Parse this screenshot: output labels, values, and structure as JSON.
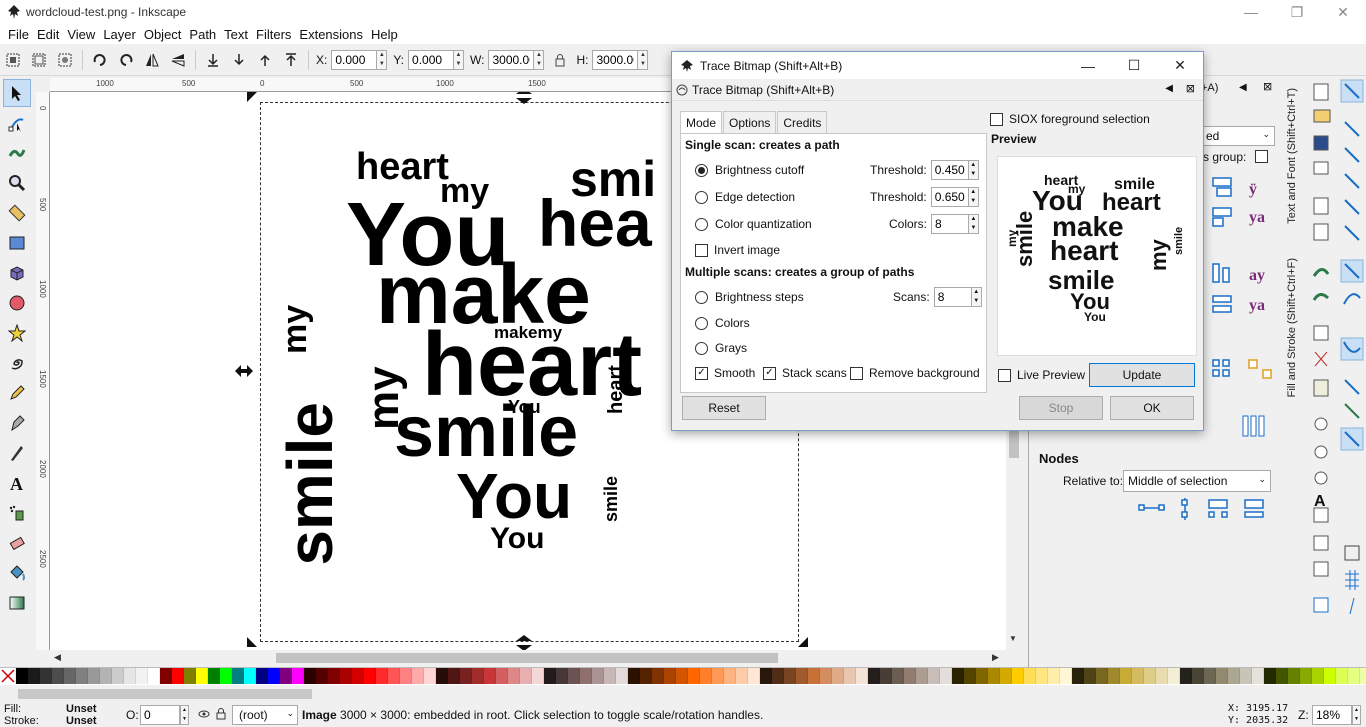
{
  "window": {
    "title": "wordcloud-test.png - Inkscape",
    "minimize": "—",
    "restore": "❐",
    "close": "✕"
  },
  "menu": [
    "File",
    "Edit",
    "View",
    "Layer",
    "Object",
    "Path",
    "Text",
    "Filters",
    "Extensions",
    "Help"
  ],
  "controls": {
    "x_label": "X:",
    "x_value": "0.000",
    "y_label": "Y:",
    "y_value": "0.000",
    "w_label": "W:",
    "w_value": "3000.00",
    "h_label": "H:",
    "h_value": "3000.00"
  },
  "ruler": {
    "top_labels": [
      "1000",
      "500",
      "0",
      "500",
      "1000",
      "1500"
    ],
    "left_labels": [
      "0",
      "500",
      "1000",
      "1500",
      "2000",
      "2500"
    ]
  },
  "canvas_words": [
    "heart",
    "my",
    "smi",
    "smile",
    "You",
    "hea",
    "my",
    "make",
    "makemy",
    "smile",
    "my",
    "heart",
    "heart",
    "You",
    "my",
    "smile",
    "smile",
    "You",
    "You"
  ],
  "dialog": {
    "title": "Trace Bitmap (Shift+Alt+B)",
    "subtitle": "Trace Bitmap (Shift+Alt+B)",
    "tabs": [
      "Mode",
      "Options",
      "Credits"
    ],
    "single_scan_header": "Single scan: creates a path",
    "brightness_cutoff": "Brightness cutoff",
    "edge_detection": "Edge detection",
    "color_quantization": "Color quantization",
    "invert_image": "Invert image",
    "threshold_label": "Threshold:",
    "threshold_1": "0.450",
    "threshold_2": "0.650",
    "colors_label": "Colors:",
    "colors_value": "8",
    "multi_scan_header": "Multiple scans: creates a group of paths",
    "brightness_steps": "Brightness steps",
    "scans_label": "Scans:",
    "scans_value": "8",
    "colors_opt": "Colors",
    "grays_opt": "Grays",
    "smooth": "Smooth",
    "stack_scans": "Stack scans",
    "remove_background": "Remove background",
    "siox": "SIOX foreground selection",
    "preview_label": "Preview",
    "live_preview": "Live Preview",
    "update": "Update",
    "reset": "Reset",
    "stop": "Stop",
    "ok": "OK"
  },
  "dock": {
    "ed_text": "ed",
    "as_group": "s group:",
    "a_tag": "+A)",
    "nodes_header": "Nodes",
    "relative_to_label": "Relative to:",
    "relative_to_value": "Middle of selection"
  },
  "vertical_tabs": {
    "text_font": "Text and Font (Shift+Ctrl+T)",
    "fill_stroke": "Fill and Stroke (Shift+Ctrl+F)"
  },
  "palette": [
    "#000000",
    "#1a1a1a",
    "#333333",
    "#4d4d4d",
    "#666666",
    "#808080",
    "#999999",
    "#b3b3b3",
    "#cccccc",
    "#e6e6e6",
    "#f2f2f2",
    "#ffffff",
    "#800000",
    "#ff0000",
    "#808000",
    "#ffff00",
    "#008000",
    "#00ff00",
    "#008080",
    "#00ffff",
    "#000080",
    "#0000ff",
    "#800080",
    "#ff00ff",
    "#2b0000",
    "#550000",
    "#800000",
    "#aa0000",
    "#d40000",
    "#ff0000",
    "#ff2a2a",
    "#ff5555",
    "#ff8080",
    "#ffaaaa",
    "#ffd5d5",
    "#280b0b",
    "#501616",
    "#782121",
    "#a02c2c",
    "#c83737",
    "#d35f5f",
    "#de8787",
    "#e9afaf",
    "#f4d7d7",
    "#241c1c",
    "#483737",
    "#6c5353",
    "#916f6f",
    "#ac9393",
    "#c8b7b7",
    "#e3dbdb",
    "#2b1100",
    "#552200",
    "#803300",
    "#aa4400",
    "#d45500",
    "#ff6600",
    "#ff7f2a",
    "#ff9955",
    "#ffb380",
    "#ffccaa",
    "#ffe6d5",
    "#28170b",
    "#502d16",
    "#784421",
    "#a05a2c",
    "#c87137",
    "#d38d5f",
    "#deaa87",
    "#e9c6af",
    "#f4e3d7",
    "#241f1c",
    "#483e37",
    "#6c5d53",
    "#917c6f",
    "#ac9d93",
    "#c8beb7",
    "#e3dedb",
    "#2b2200",
    "#554400",
    "#806600",
    "#aa8800",
    "#d4aa00",
    "#ffcc00",
    "#ffdd55",
    "#ffe680",
    "#ffeeaa",
    "#fff6d5",
    "#28220b",
    "#504416",
    "#786721",
    "#a0892c",
    "#c8ab37",
    "#d3bc5f",
    "#decd87",
    "#e9ddaf",
    "#f4eed7",
    "#24221c",
    "#484537",
    "#6c6753",
    "#918a6f",
    "#aca793",
    "#c8c4b7",
    "#e3e2db",
    "#222b00",
    "#445500",
    "#668000",
    "#88aa00",
    "#aad400",
    "#ccff00",
    "#ddff55",
    "#e5ff80",
    "#eeffaa",
    "#f6ffd5",
    "#1e280b",
    "#3c5016",
    "#5a7821",
    "#78a02c",
    "#96c837",
    "#abd35f",
    "#c0de87",
    "#d5e9af",
    "#eaf4d7",
    "#1f241c",
    "#3e4837",
    "#5d6c53",
    "#7c916f",
    "#9dac93",
    "#bec8b7",
    "#dee3db",
    "#112b00",
    "#225500",
    "#338000",
    "#44aa00"
  ],
  "status": {
    "fill_label": "Fill:",
    "fill_value": "Unset",
    "stroke_label": "Stroke:",
    "stroke_value": "Unset",
    "opacity_label": "O:",
    "opacity_value": "0",
    "layer_value": "(root)",
    "message_bold": "Image",
    "message": " 3000 × 3000: embedded in root. Click selection to toggle scale/rotation handles.",
    "cursor_x": "X: 3195.17",
    "cursor_y": "Y: 2035.32",
    "zoom_label": "Z:",
    "zoom_value": "18%"
  }
}
